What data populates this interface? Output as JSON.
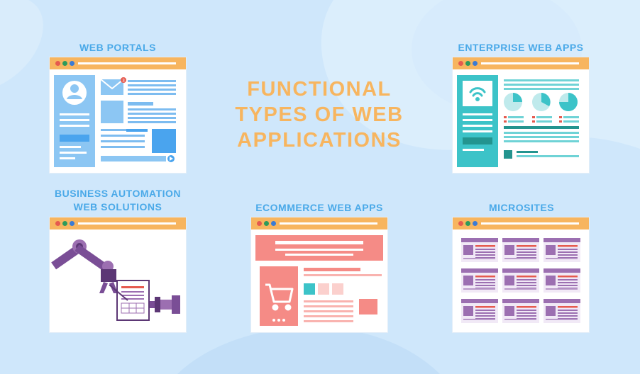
{
  "title_lines": [
    "FUNCTIONAL",
    "TYPES OF WEB",
    "APPLICATIONS"
  ],
  "panels": {
    "web_portals": "WEB PORTALS",
    "enterprise": "ENTERPRISE WEB APPS",
    "business_automation": [
      "BUSINESS AUTOMATION",
      "WEB SOLUTIONS"
    ],
    "ecommerce": "ECOMMERCE WEB APPS",
    "microsites": "MICROSITES"
  },
  "notification_count": "3",
  "colors": {
    "background": "#cfe7fb",
    "accent_orange": "#f7b55f",
    "label_blue": "#4aa9e8",
    "dot_red": "#e55a4f",
    "dot_green": "#2d9b5b",
    "dot_blue": "#3a7bd5",
    "portal_blue": "#7dbcf0",
    "enterprise_teal": "#36c3c9",
    "ecommerce_pink": "#f58b86",
    "microsite_purple": "#9c6fb1",
    "robot_purple": "#7a4e96"
  },
  "icons": [
    "user-avatar-icon",
    "mail-icon",
    "play-arrow-icon",
    "wifi-icon",
    "pie-chart-icon",
    "shopping-cart-icon",
    "robot-arm-icon"
  ]
}
